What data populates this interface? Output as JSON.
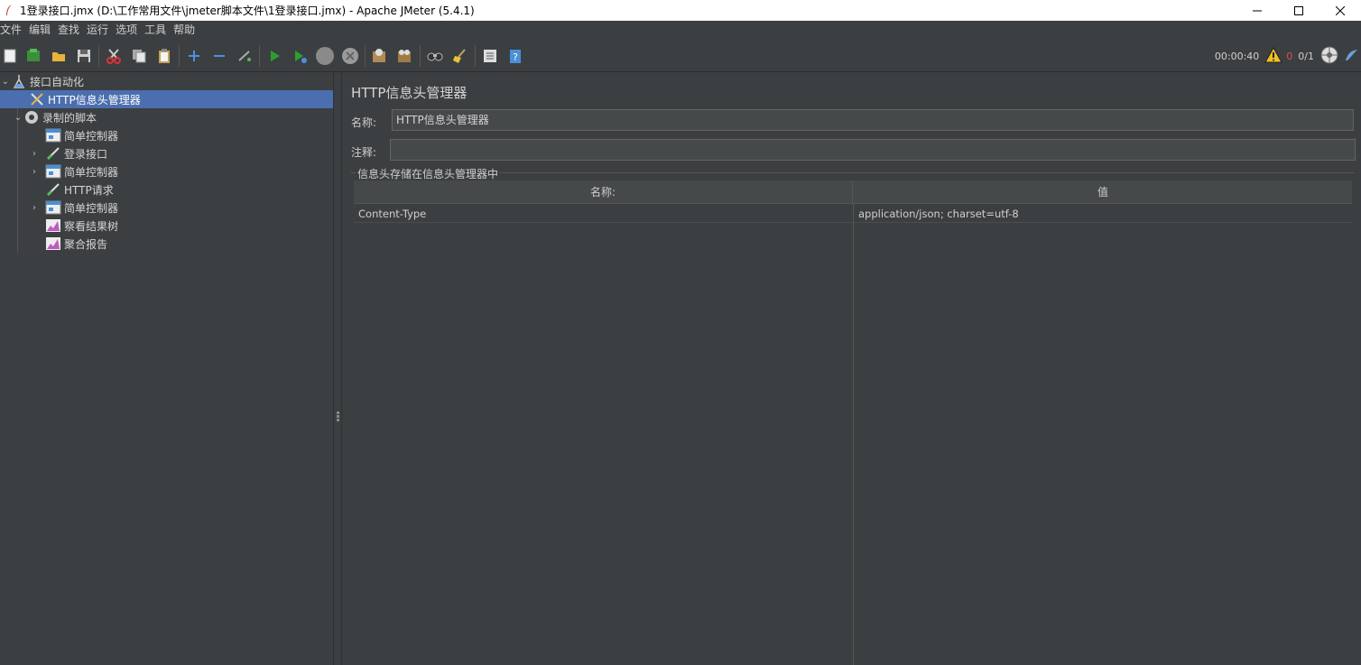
{
  "window": {
    "title": "1登录接口.jmx (D:\\工作常用文件\\jmeter脚本文件\\1登录接口.jmx) - Apache JMeter (5.4.1)",
    "minimize": "—",
    "maximize": "☐",
    "close": "✕"
  },
  "menu": [
    "文件",
    "编辑",
    "查找",
    "运行",
    "选项",
    "工具",
    "帮助"
  ],
  "toolbar": {
    "timer": "00:00:40",
    "error_count": "0",
    "threads": "0/1"
  },
  "tree": {
    "items": [
      {
        "label": "接口自动化",
        "icon": "test-plan-icon",
        "expanded": true
      },
      {
        "label": "HTTP信息头管理器",
        "icon": "header-manager-icon",
        "selected": true
      },
      {
        "label": "录制的脚本",
        "icon": "thread-group-icon",
        "expanded": true
      },
      {
        "label": "简单控制器",
        "icon": "simple-controller-icon"
      },
      {
        "label": "登录接口",
        "icon": "sampler-icon",
        "expandable": true
      },
      {
        "label": "简单控制器",
        "icon": "simple-controller-icon",
        "expandable": true
      },
      {
        "label": "HTTP请求",
        "icon": "sampler-icon"
      },
      {
        "label": "简单控制器",
        "icon": "simple-controller-icon",
        "expandable": true
      },
      {
        "label": "察看结果树",
        "icon": "listener-icon"
      },
      {
        "label": "聚合报告",
        "icon": "listener-icon"
      }
    ]
  },
  "main": {
    "title": "HTTP信息头管理器",
    "name_label": "名称:",
    "name_value": "HTTP信息头管理器",
    "comment_label": "注释:",
    "comment_value": "",
    "group_title": "信息头存储在信息头管理器中",
    "table": {
      "headers": [
        "名称:",
        "值"
      ],
      "rows": [
        [
          "Content-Type",
          "application/json; charset=utf-8"
        ]
      ]
    }
  },
  "colors": {
    "background": "#3c3f41",
    "selection": "#4b6eaf",
    "input_bg": "#45494a"
  }
}
